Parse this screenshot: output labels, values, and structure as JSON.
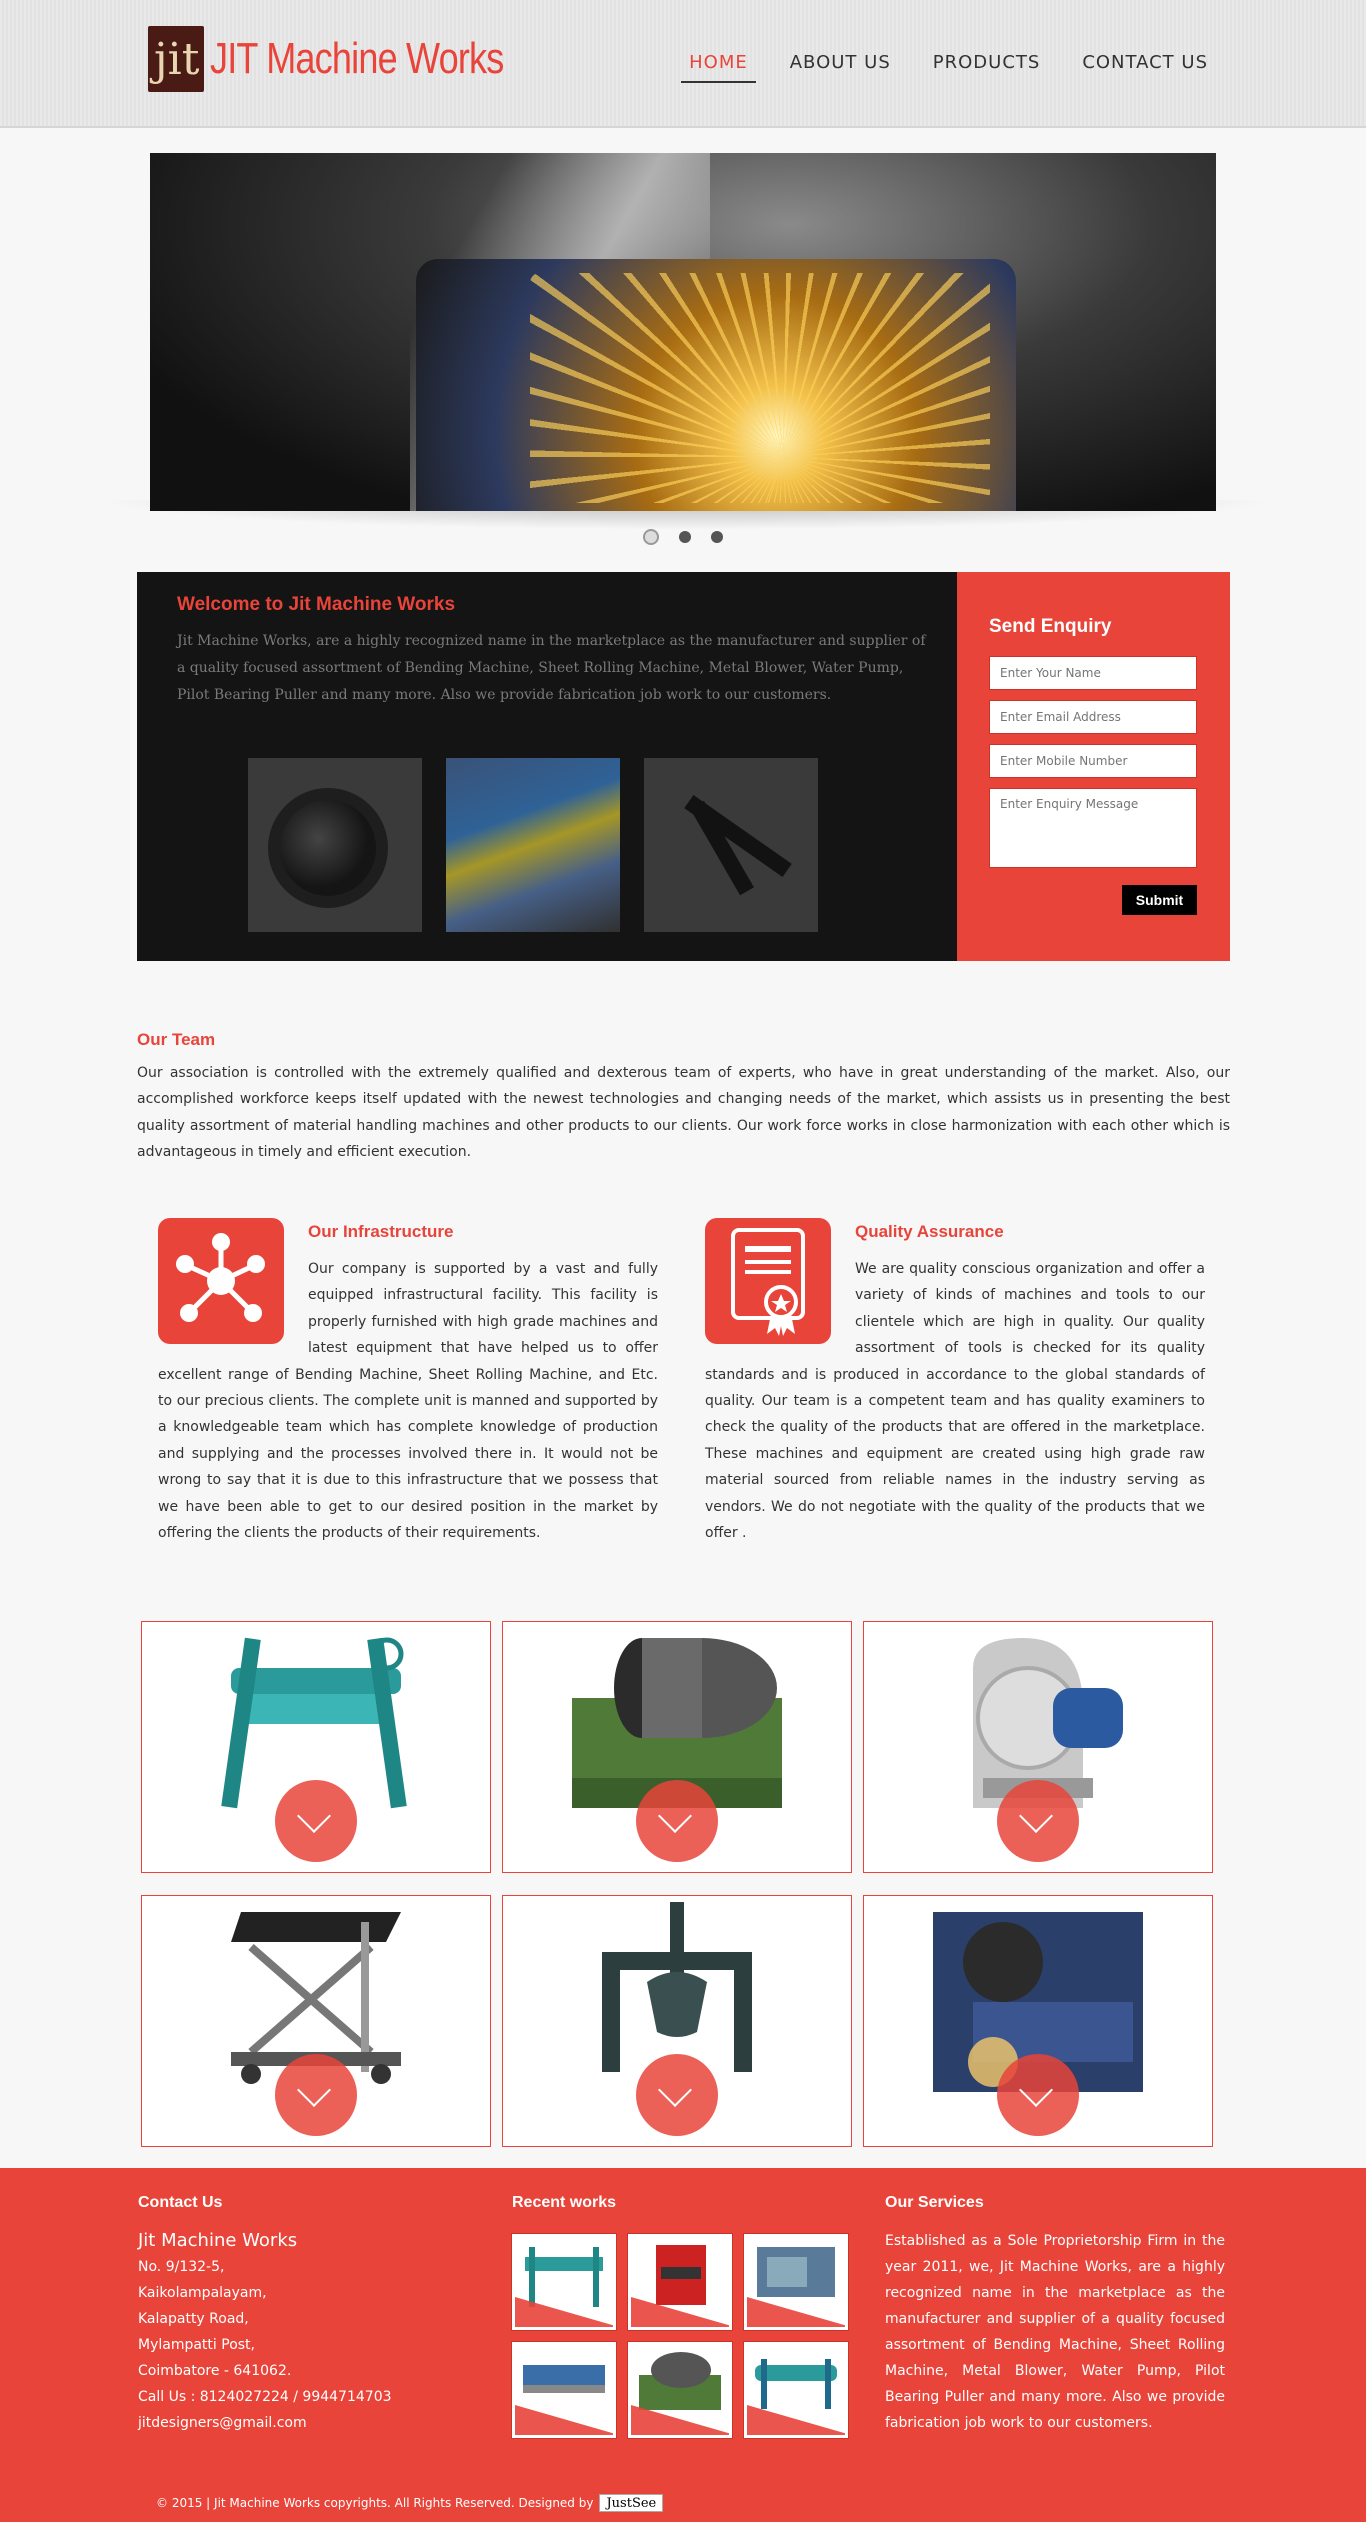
{
  "brand": {
    "name": "JIT Machine Works",
    "mark": "jit",
    "accent": "#e8443a",
    "dark": "#141414"
  },
  "nav": {
    "items": [
      "HOME",
      "ABOUT US",
      "PRODUCTS",
      "CONTACT US"
    ],
    "active": "HOME"
  },
  "slider": {
    "slides": 3,
    "active_index": 0
  },
  "welcome": {
    "title": "Welcome to Jit Machine Works",
    "text": "Jit Machine Works, are a highly recognized name in the marketplace as the manufacturer and supplier of a quality focused assortment of Bending Machine, Sheet Rolling Machine, Metal Blower, Water Pump, Pilot Bearing Puller and many more. Also we provide fabrication job work to our customers."
  },
  "enquiry": {
    "title": "Send Enquiry",
    "name_placeholder": "Enter Your Name",
    "email_placeholder": "Enter Email Address",
    "mobile_placeholder": "Enter Mobile Number",
    "message_placeholder": "Enter Enquiry Message",
    "submit_label": "Submit"
  },
  "team": {
    "title": "Our Team",
    "text": "Our association is controlled with the extremely qualified and dexterous team of experts, who have in great understanding of the market. Also, our accomplished workforce keeps itself updated with the newest technologies and changing needs of the market, which assists us in presenting the best quality assortment of material handling machines and other products to our clients. Our work force works in close harmonization with each other which is advantageous in timely and efficient execution."
  },
  "infrastructure": {
    "title": "Our Infrastructure",
    "icon": "network-icon",
    "text": "Our company is supported by a vast and fully equipped infrastructural facility. This facility is properly furnished with high grade machines and latest equipment that have helped us to offer excellent range of Bending Machine, Sheet Rolling Machine, and Etc. to our precious clients. The complete unit is manned and supported by a knowledgeable team which has complete knowledge of production and supplying and the processes involved there in. It would not be wrong to say that it is due to this infrastructure that we possess that we have been able to get to our desired position in the market by offering the clients the products of their requirements."
  },
  "quality": {
    "title": "Quality Assurance",
    "icon": "certificate-icon",
    "text": "We are quality conscious organization and offer a variety of kinds of machines and tools to our clientele which are high in quality. Our quality assortment of tools is checked for its quality standards and is produced in accordance to the global standards of quality. Our team is a competent team and has quality examiners to check the quality of the products that are offered in the marketplace. These machines and equipment are created using high grade raw material sourced from reliable names in the industry serving as vendors. We do not negotiate with the quality of the products that we offer ."
  },
  "products": [
    {
      "icon": "bending-machine-icon"
    },
    {
      "icon": "sheet-rolling-machine-icon"
    },
    {
      "icon": "metal-blower-icon"
    },
    {
      "icon": "lift-table-icon"
    },
    {
      "icon": "bearing-puller-icon"
    },
    {
      "icon": "welding-icon"
    }
  ],
  "footer": {
    "contact_title": "Contact Us",
    "company": "Jit Machine Works",
    "address": [
      "No. 9/132-5,",
      "Kaikolampalayam,",
      "Kalapatty Road,",
      "Mylampatti Post,",
      "Coimbatore - 641062."
    ],
    "phone": "Call Us : 8124027224  /  9944714703",
    "email": "jitdesigners@gmail.com",
    "recent_title": "Recent works",
    "services_title": "Our Services",
    "services_text": "Established as a Sole Proprietorship Firm in the year 2011, we, Jit Machine Works, are a highly recognized name in the marketplace as the manufacturer and supplier of a quality focused assortment of Bending Machine, Sheet Rolling Machine, Metal Blower, Water Pump, Pilot Bearing Puller and many more. Also we provide fabrication job work to our customers.",
    "copyright": "© 2015 | Jit Machine Works copyrights. All Rights Reserved. Designed by",
    "designer": "JustSee"
  }
}
